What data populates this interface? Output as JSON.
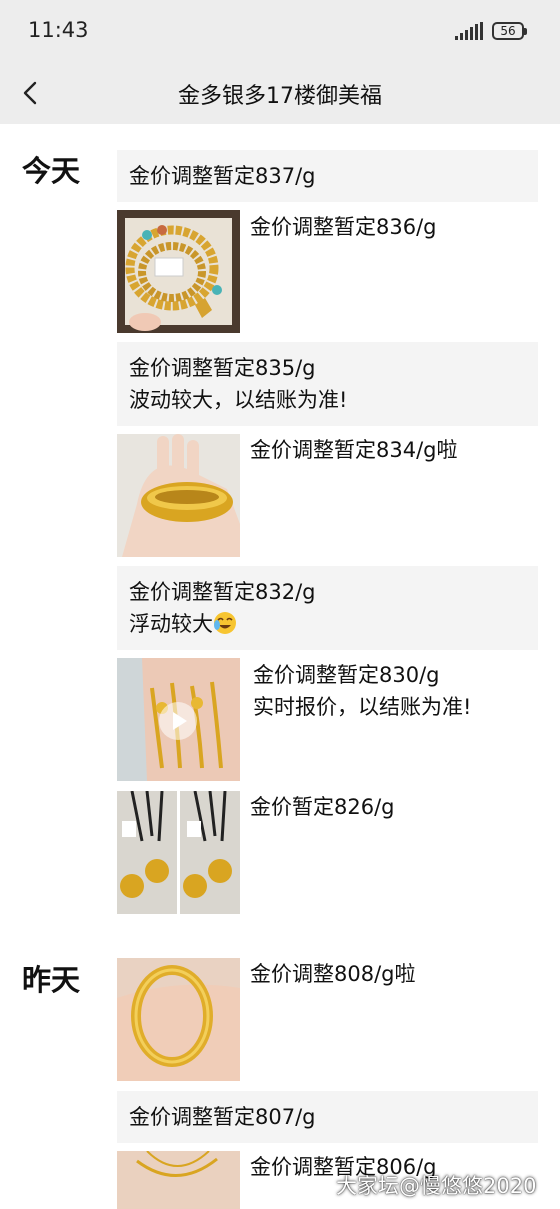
{
  "status_bar": {
    "time": "11:43",
    "battery": "56"
  },
  "header": {
    "title": "金多银多17楼御美福"
  },
  "today": {
    "label": "今天",
    "posts": [
      {
        "lines": [
          "金价调整暂定837/g"
        ]
      },
      {
        "caption": [
          "金价调整暂定836/g"
        ],
        "image": "gold-bead-bracelet-photo"
      },
      {
        "lines": [
          "金价调整暂定835/g",
          "波动较大，以结账为准!"
        ]
      },
      {
        "caption": [
          "金价调整暂定834/g啦"
        ],
        "image": "gold-bangle-on-hand-photo"
      },
      {
        "lines": [
          "金价调整暂定832/g",
          "浮动较大"
        ],
        "emoji": "crying-laughing-emoji"
      },
      {
        "caption": [
          "金价调整暂定830/g",
          "实时报价，以结账为准!"
        ],
        "image": "gold-bracelets-video"
      },
      {
        "caption": [
          "金价暂定826/g"
        ],
        "image": "gold-coin-pendants-collage"
      }
    ]
  },
  "yesterday": {
    "label": "昨天",
    "posts": [
      {
        "caption": [
          "金价调整808/g啦"
        ],
        "image": "gold-bangle-on-wrist-photo"
      },
      {
        "lines": [
          "金价调整暂定807/g"
        ]
      },
      {
        "caption": [
          "金价调整暂定806/g"
        ],
        "image": "gold-chain-photo"
      }
    ]
  },
  "watermark": "大家坛@慢悠悠2020",
  "colors": {
    "header_bg": "#ededed",
    "card_bg": "#f4f4f4",
    "gold": "#d9a521"
  }
}
